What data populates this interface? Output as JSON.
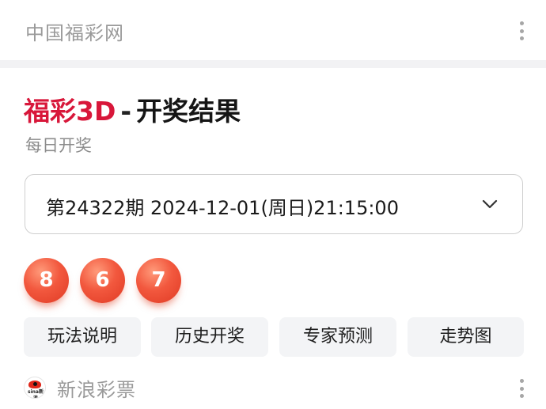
{
  "header": {
    "site_name": "中国福彩网"
  },
  "result": {
    "title_brand": "福彩3D",
    "title_separator": "-",
    "title_rest": "开奖结果",
    "subtitle": "每日开奖",
    "issue_text": "第24322期 2024-12-01(周日)21:15:00",
    "numbers": [
      "8",
      "6",
      "7"
    ],
    "ball_color": "#f2583e",
    "brand_color": "#d8173a"
  },
  "actions": [
    {
      "label": "玩法说明"
    },
    {
      "label": "历史开奖"
    },
    {
      "label": "专家预测"
    },
    {
      "label": "走势图"
    }
  ],
  "source": {
    "name": "新浪彩票",
    "logo_text": "sina新浪"
  },
  "icons": {
    "menu": "more-vertical-icon",
    "dropdown": "chevron-down-icon",
    "logo": "sina-logo-icon"
  }
}
